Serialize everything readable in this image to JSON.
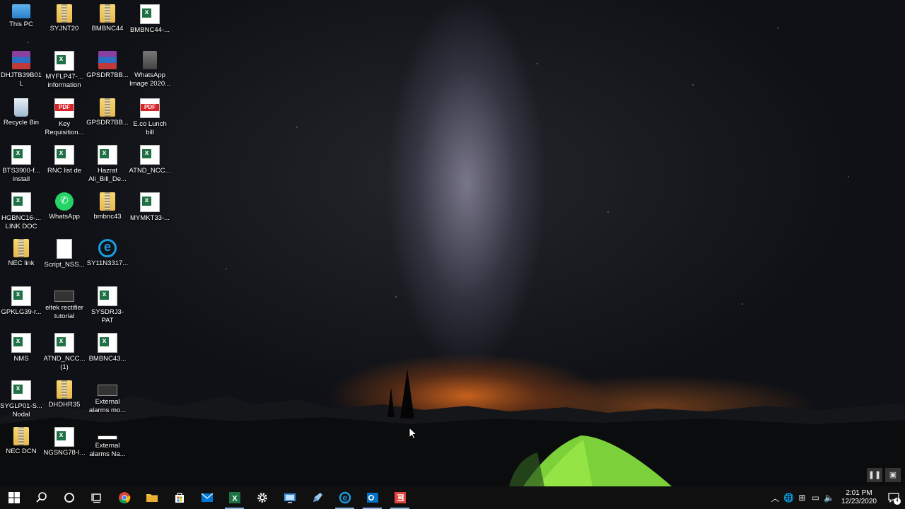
{
  "desktop": {
    "icons": [
      {
        "label": "This PC",
        "icon": "this-pc-icon",
        "kind": "pc"
      },
      {
        "label": "DHJTB39B01L",
        "icon": "winrar-archive-icon",
        "kind": "rar"
      },
      {
        "label": "Recycle Bin",
        "icon": "recycle-bin-icon",
        "kind": "bin"
      },
      {
        "label": "BTS3900-f... install",
        "icon": "excel-file-icon",
        "kind": "excel"
      },
      {
        "label": "HGBNC16-... LINK DOC",
        "icon": "excel-file-icon",
        "kind": "excel"
      },
      {
        "label": "NEC link",
        "icon": "folder-icon",
        "kind": "folder"
      },
      {
        "label": "GPKLG39-r...",
        "icon": "excel-file-icon",
        "kind": "excel"
      },
      {
        "label": "NMS",
        "icon": "excel-file-icon",
        "kind": "excel"
      },
      {
        "label": "SYGLP01-S... Nodal",
        "icon": "excel-file-icon",
        "kind": "excel"
      },
      {
        "label": "NEC DCN",
        "icon": "folder-icon",
        "kind": "folder"
      },
      {
        "label": "SYJNT20",
        "icon": "folder-icon",
        "kind": "folder"
      },
      {
        "label": "MYFLP47-... information",
        "icon": "excel-file-icon",
        "kind": "excel"
      },
      {
        "label": "Key Requisition...",
        "icon": "pdf-file-icon",
        "kind": "pdf"
      },
      {
        "label": "RNC list de",
        "icon": "excel-file-icon",
        "kind": "excel"
      },
      {
        "label": "WhatsApp",
        "icon": "whatsapp-icon",
        "kind": "wa"
      },
      {
        "label": "Script_NSS...",
        "icon": "text-file-icon",
        "kind": "doc"
      },
      {
        "label": "eltek rectifier tutorial",
        "icon": "video-file-icon",
        "kind": "app"
      },
      {
        "label": "ATND_NCC... (1)",
        "icon": "excel-file-icon",
        "kind": "excel"
      },
      {
        "label": "DHDHR35",
        "icon": "folder-icon",
        "kind": "folder"
      },
      {
        "label": "NGSNG78-I...",
        "icon": "excel-file-icon",
        "kind": "excel"
      },
      {
        "label": "BMBNC44",
        "icon": "folder-icon",
        "kind": "folder"
      },
      {
        "label": "GPSDR7BB...",
        "icon": "winrar-archive-icon",
        "kind": "rar"
      },
      {
        "label": "GPSDR7BB...",
        "icon": "folder-icon",
        "kind": "folder"
      },
      {
        "label": "Hazrat Ali_Bill_De...",
        "icon": "excel-file-icon",
        "kind": "excel"
      },
      {
        "label": "bmbnc43",
        "icon": "folder-icon",
        "kind": "folder"
      },
      {
        "label": "SY11N3317...",
        "icon": "internet-shortcut-icon",
        "kind": "ie"
      },
      {
        "label": "SYSDRJ3-PAT",
        "icon": "excel-file-icon",
        "kind": "excel"
      },
      {
        "label": "BMBNC43...",
        "icon": "excel-file-icon",
        "kind": "excel"
      },
      {
        "label": "External alarms mo...",
        "icon": "video-file-icon",
        "kind": "app"
      },
      {
        "label": "External alarms Na...",
        "icon": "image-file-icon",
        "kind": "blank"
      },
      {
        "label": "BMBNC44-...",
        "icon": "excel-file-icon",
        "kind": "excel"
      },
      {
        "label": "WhatsApp Image 2020...",
        "icon": "image-file-icon",
        "kind": "img"
      },
      {
        "label": "E.co Lunch bill",
        "icon": "pdf-file-icon",
        "kind": "pdf"
      },
      {
        "label": "ATND_NCC...",
        "icon": "excel-file-icon",
        "kind": "excel"
      },
      {
        "label": "MYMKT33-...",
        "icon": "excel-file-icon",
        "kind": "excel"
      }
    ]
  },
  "overlay": {
    "pause": "❚❚",
    "pip": "▣"
  },
  "taskbar": {
    "buttons": [
      {
        "name": "start-button",
        "icon": "windows-logo-icon",
        "running": false
      },
      {
        "name": "search-button",
        "icon": "search-icon",
        "running": false
      },
      {
        "name": "cortana-button",
        "icon": "circle-icon",
        "running": false
      },
      {
        "name": "task-view-button",
        "icon": "task-view-icon",
        "running": false
      },
      {
        "name": "chrome-button",
        "icon": "chrome-icon",
        "running": false
      },
      {
        "name": "file-explorer-button",
        "icon": "folder-icon",
        "running": false
      },
      {
        "name": "store-button",
        "icon": "store-icon",
        "running": false
      },
      {
        "name": "mail-button",
        "icon": "mail-icon",
        "running": false
      },
      {
        "name": "excel-button",
        "icon": "excel-icon",
        "running": true
      },
      {
        "name": "settings-button",
        "icon": "gear-icon",
        "running": false
      },
      {
        "name": "remote-desktop-button",
        "icon": "remote-desktop-icon",
        "running": false
      },
      {
        "name": "notepad-button",
        "icon": "pen-icon",
        "running": false
      },
      {
        "name": "edge-button",
        "icon": "edge-icon",
        "running": true
      },
      {
        "name": "outlook-button",
        "icon": "outlook-icon",
        "running": true
      },
      {
        "name": "app-button",
        "icon": "red-app-icon",
        "running": true
      }
    ],
    "tray": {
      "chevron": "︿",
      "clock_time": "2:01 PM",
      "clock_date": "12/23/2020",
      "notification_count": "4"
    }
  },
  "colors": {
    "taskbar": "#101010",
    "excel": "#1e7145",
    "accent": "#1b9de2"
  }
}
